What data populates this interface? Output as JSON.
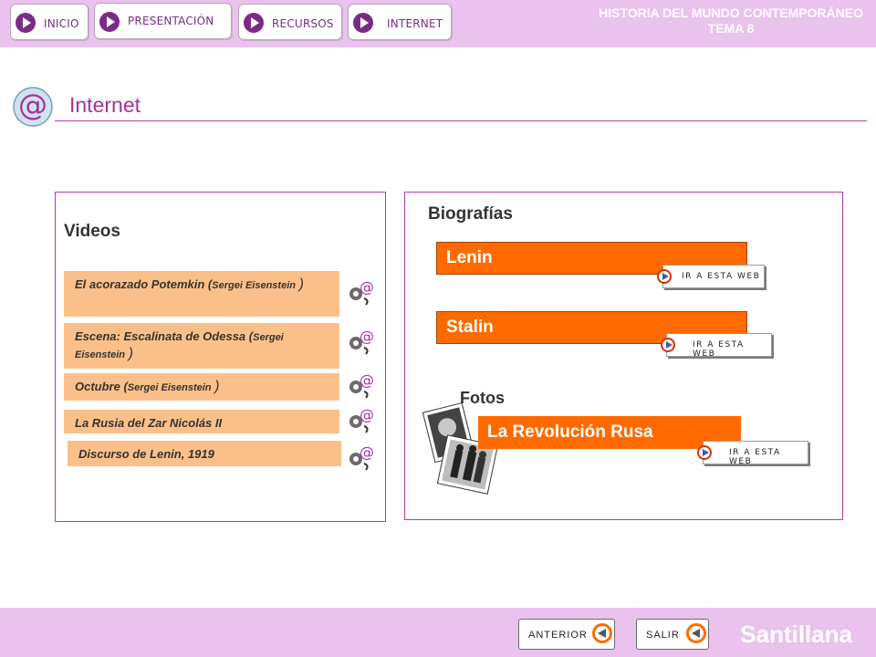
{
  "nav": {
    "items": [
      {
        "label": "INICIO"
      },
      {
        "label": "PRESENTACIÓN"
      },
      {
        "label": "RECURSOS"
      },
      {
        "label": "INTERNET"
      }
    ],
    "course_line1": "HISTORIA DEL MUNDO CONTEMPORÁNEO",
    "course_line2": "TEMA 8"
  },
  "page": {
    "title": "Internet",
    "title_icon": "at-sign-icon"
  },
  "videos": {
    "heading": "Videos",
    "items": [
      {
        "title": "El acorazado Potemkin (",
        "author": "Sergei Eisenstein",
        "close": ")"
      },
      {
        "title": "Escena: Escalinata de Odessa  (",
        "author": "Sergei Eisenstein",
        "close": ")"
      },
      {
        "title": "Octubre  (",
        "author": "Sergei Eisenstein",
        "close": ")"
      },
      {
        "title": "La Rusia del Zar Nicolás II"
      },
      {
        "title": "Discurso de Lenin, 1919"
      }
    ],
    "icon": "film-reel-at-icon"
  },
  "biografias": {
    "heading": "Biografías",
    "items": [
      {
        "label": "Lenin"
      },
      {
        "label": "Stalin"
      }
    ],
    "link_label": "IR A ESTA WEB"
  },
  "fotos": {
    "heading": "Fotos",
    "item": "La Revolución Rusa",
    "link_label": "IR A ESTA WEB",
    "icon": "photos-stack-icon"
  },
  "footer": {
    "prev_label": "ANTERIOR",
    "exit_label": "SALIR",
    "brand": "Santillana"
  },
  "colors": {
    "topbar": "#e9c2ed",
    "accent_purple": "#b23aa9",
    "orange": "#ff6a00",
    "video_row": "#fbc089"
  }
}
